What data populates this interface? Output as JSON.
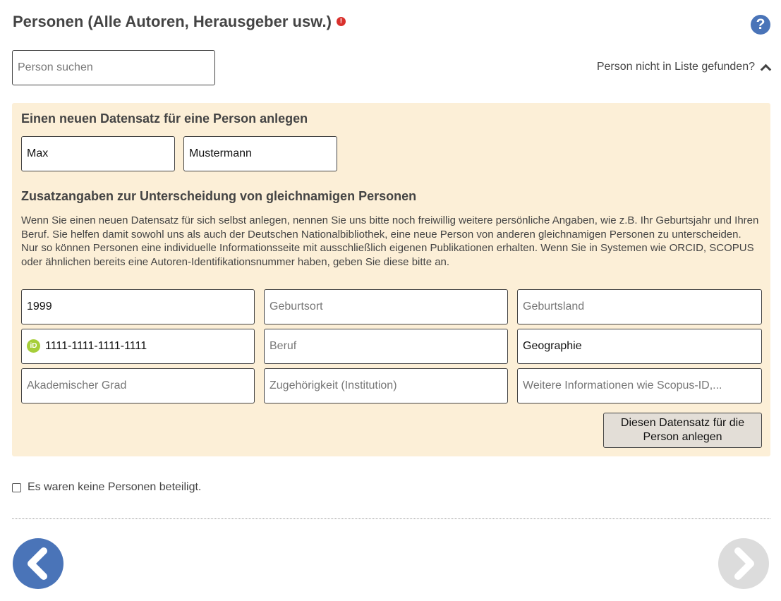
{
  "section": {
    "title": "Personen (Alle Autoren, Herausgeber usw.)",
    "required_icon": "exclamation-icon",
    "help_icon": "question-icon"
  },
  "search": {
    "placeholder": "Person suchen",
    "value": ""
  },
  "not_found_link": {
    "label": "Person nicht in Liste gefunden?",
    "icon": "chevron-up-icon"
  },
  "new_person": {
    "heading": "Einen neuen Datensatz für eine Person anlegen",
    "first_name": "Max",
    "last_name": "Mustermann",
    "extra_heading": "Zusatzangaben zur Unterscheidung von gleichnamigen Personen",
    "extra_text": "Wenn Sie einen neuen Datensatz für sich selbst anlegen, nennen Sie uns bitte noch freiwillig weitere persönliche Angaben, wie z.B. Ihr Geburtsjahr und Ihren Beruf. Sie helfen damit sowohl uns als auch der Deutschen Nationalbibliothek, eine neue Person von anderen gleichnamigen Personen zu unterscheiden. Nur so können Personen eine individuelle Informationsseite mit ausschließlich eigenen Publikationen erhalten. Wenn Sie in Systemen wie ORCID, SCOPUS oder ähnlichen bereits eine Autoren-Identifikationsnummer haben, geben Sie diese bitte an.",
    "fields": {
      "birth_year": {
        "value": "1999",
        "placeholder": ""
      },
      "birth_place": {
        "value": "",
        "placeholder": "Geburtsort"
      },
      "birth_country": {
        "value": "",
        "placeholder": "Geburtsland"
      },
      "orcid": {
        "value": "1111-1111-1111-1111",
        "placeholder": "",
        "icon": "orcid-icon",
        "icon_text": "iD"
      },
      "profession": {
        "value": "",
        "placeholder": "Beruf"
      },
      "subject": {
        "value": "Geographie",
        "placeholder": ""
      },
      "academic_degree": {
        "value": "",
        "placeholder": "Akademischer Grad"
      },
      "affiliation": {
        "value": "",
        "placeholder": "Zugehörigkeit (Institution)"
      },
      "further_info": {
        "value": "",
        "placeholder": "Weitere Informationen wie Scopus-ID,..."
      }
    },
    "create_button": "Diesen Datensatz für die Person anlegen",
    "colors": {
      "panel_background": "#fcefd7",
      "button_background": "#e3ded7"
    }
  },
  "no_persons_checkbox": {
    "label": "Es waren keine Personen beteiligt.",
    "checked": false
  },
  "navigation": {
    "prev_icon": "chevron-left-icon",
    "next_icon": "chevron-right-icon",
    "colors": {
      "prev": "#4a74b8",
      "next": "#dcdcdc"
    }
  }
}
